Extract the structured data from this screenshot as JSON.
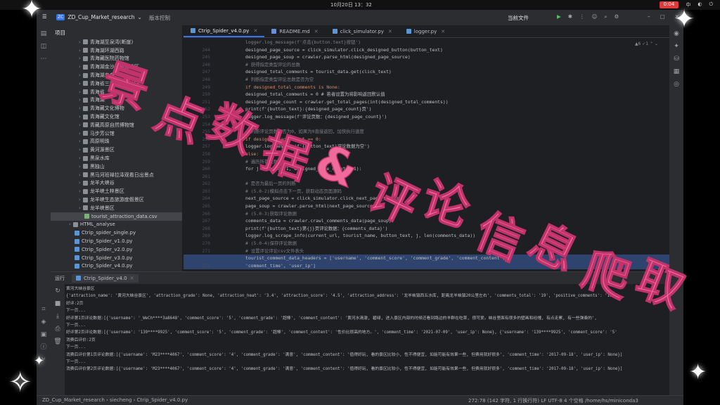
{
  "os": {
    "clock": "10月20日 13：32",
    "rec": "0:04",
    "indicators": [
      "中",
      "◐",
      "⏻"
    ]
  },
  "ide": {
    "project_badge": "ZC",
    "project_name": "ZD_Cup_Market_research",
    "version_control": "版本控制",
    "run_config": "当前文件",
    "project_panel_title": "项目"
  },
  "tree": [
    {
      "label": "青海湖至泉湾(断崖)",
      "indent": 40,
      "type": "folder"
    },
    {
      "label": "青海湖环湖西路",
      "indent": 40,
      "type": "folder"
    },
    {
      "label": "青海藏医院药物馆",
      "indent": 40,
      "type": "folder"
    },
    {
      "label": "青海湖金沙湾旅游景区",
      "indent": 40,
      "type": "folder"
    },
    {
      "label": "青海湖鸟岛",
      "indent": 40,
      "type": "folder"
    },
    {
      "label": "青海省三江源国家公园",
      "indent": 40,
      "type": "folder"
    },
    {
      "label": "青海省",
      "indent": 40,
      "type": "folder"
    },
    {
      "label": "青海湖",
      "indent": 40,
      "type": "folder"
    },
    {
      "label": "青海藏文化博物",
      "indent": 40,
      "type": "folder"
    },
    {
      "label": "青海藏文化馆",
      "indent": 40,
      "type": "folder"
    },
    {
      "label": "青藏高原自然博物馆",
      "indent": 40,
      "type": "folder"
    },
    {
      "label": "马步芳公馆",
      "indent": 40,
      "type": "folder"
    },
    {
      "label": "高原明珠",
      "indent": 40,
      "type": "folder"
    },
    {
      "label": "黄河源景区",
      "indent": 40,
      "type": "folder"
    },
    {
      "label": "黑泉水库",
      "indent": 40,
      "type": "folder"
    },
    {
      "label": "黑独山",
      "indent": 40,
      "type": "folder"
    },
    {
      "label": "黑马河班禅拉泽观看日出景点",
      "indent": 40,
      "type": "folder"
    },
    {
      "label": "龙羊大峡谷",
      "indent": 40,
      "type": "folder"
    },
    {
      "label": "龙羊峡土林景区",
      "indent": 40,
      "type": "folder"
    },
    {
      "label": "龙羊峡生态旅游度假景区",
      "indent": 40,
      "type": "folder"
    },
    {
      "label": "龙羊峡景区",
      "indent": 40,
      "type": "folder"
    },
    {
      "label": "tourist_attraction_data.csv",
      "indent": 40,
      "type": "csv",
      "selected": true
    },
    {
      "label": "HTML_analyse",
      "indent": 26,
      "type": "folder"
    },
    {
      "label": "Ctrip_spider_single.py",
      "indent": 26,
      "type": "file"
    },
    {
      "label": "Ctrip_Spider_v1.0.py",
      "indent": 26,
      "type": "file"
    },
    {
      "label": "Ctrip_Spider_v2.0.py",
      "indent": 26,
      "type": "file"
    },
    {
      "label": "Ctrip_Spider_v3.0.py",
      "indent": 26,
      "type": "file"
    },
    {
      "label": "Ctrip_Spider_v4.0.py",
      "indent": 26,
      "type": "file"
    }
  ],
  "tabs": [
    {
      "label": "Ctrip_Spider_v4.0.py",
      "active": true
    },
    {
      "label": "README.md",
      "active": false
    },
    {
      "label": "click_simulator.py",
      "active": false
    },
    {
      "label": "logger.py",
      "active": false
    }
  ],
  "inspection": "▲6 ✓1 ⌃ ⌄",
  "code_lines": [
    {
      "n": "",
      "text": "logger.log_message(f'点击{button.text}按钮')",
      "cls": "cm"
    },
    {
      "n": "244",
      "text": "designed_page_source = click_simulator.click_designed_button(button_text)",
      "cls": ""
    },
    {
      "n": "245",
      "text": "designed_page_soup = crawler.parse_html(designed_page_source)",
      "cls": ""
    },
    {
      "n": "246",
      "text": "# 获得指定类型评论的总数",
      "cls": "cm"
    },
    {
      "n": "247",
      "text": "designed_total_comments = tourist_data.get(click_text)",
      "cls": ""
    },
    {
      "n": "248",
      "text": "# 判断指定类型评论总数是否为空",
      "cls": "cm"
    },
    {
      "n": "249",
      "text": "if designed_total_comments is None:",
      "cls": "kw"
    },
    {
      "n": "250",
      "text": "    designed_total_comments = 0  # 若者设置为将影响返回默认值",
      "cls": ""
    },
    {
      "n": "251",
      "text": "designed_page_count = crawler.get_total_pages(int(designed_total_comments))",
      "cls": ""
    },
    {
      "n": "252",
      "text": "print(f'{button_text}:{designed_page_count}页')",
      "cls": ""
    },
    {
      "n": "253",
      "text": "logger.log_message(f'评论页数：{designed_page_count}')",
      "cls": ""
    },
    {
      "n": "254",
      "text": "",
      "cls": ""
    },
    {
      "n": "255",
      "text": "# 判断评论页数是否为0，如果为0直接返回，加快执行速度",
      "cls": "cm"
    },
    {
      "n": "256",
      "text": "if designed_page_count == 0:",
      "cls": "kw"
    },
    {
      "n": "257",
      "text": "    logger.log_message(f'{button_text}评论数据为空')",
      "cls": ""
    },
    {
      "n": "258",
      "text": "else:",
      "cls": "kw"
    },
    {
      "n": "259",
      "text": "    # 遍历所有页数",
      "cls": "cm"
    },
    {
      "n": "260",
      "text": "    for j in range(1, designed_page_count + 1):",
      "cls": ""
    },
    {
      "n": "261",
      "text": "",
      "cls": ""
    },
    {
      "n": "262",
      "text": "        # 是否为最后一页的判断",
      "cls": "cm"
    },
    {
      "n": "263",
      "text": "        # (5.0-2)模拟点击下一页，获取动态页面源码",
      "cls": "cm"
    },
    {
      "n": "264",
      "text": "        next_page_source = click_simulator.click_next_page_button()",
      "cls": ""
    },
    {
      "n": "265",
      "text": "        page_soup = crawler.parse_html(next_page_source)",
      "cls": ""
    },
    {
      "n": "266",
      "text": "        # (5.0-3)获取评论数据",
      "cls": "cm"
    },
    {
      "n": "267",
      "text": "        comments_data = crawler.crawl_comments_data(page_soup)",
      "cls": ""
    },
    {
      "n": "268",
      "text": "        print(f'{button_text}第{j}页评论数据：{comments_data}')",
      "cls": ""
    },
    {
      "n": "269",
      "text": "        logger.log_scrape_info(current_url, tourist_name, button_text, j, len(comments_data))",
      "cls": ""
    },
    {
      "n": "270",
      "text": "        # (5.0-4)保存评论数据",
      "cls": "cm"
    },
    {
      "n": "271",
      "text": "        # 设置评论评论csv文件表头",
      "cls": "cm"
    },
    {
      "n": "",
      "text": "        tourist_comment_data_headers = ['username', 'comment_score', 'comment_grade', 'comment_content',",
      "cls": "",
      "hl": true
    },
    {
      "n": "272",
      "text": "                                        'comment_time', 'user_ip']",
      "cls": "",
      "hl": true
    }
  ],
  "run": {
    "panel_title": "运行",
    "tab": "Ctrip_Spider_v4.0"
  },
  "console_lines": [
    "黄河大峡谷景区",
    "{'attraction_name': '黄河大峡谷景区', 'attraction_grade': None, 'attraction_heat': '3.4', 'attraction_score': '4.5', 'attraction_address': '龙羊峡镇西五水库, 距离龙羊峡镇20公里左右', 'comments_total': '19', 'positive_comments': '10'",
    "好评:2页",
    "下一页...",
    "好评第1页评论数据:[{'username': '_WeCh****3a8648', 'comment_score': '5', 'comment_grade': '超棒', 'comment_content': '黄河水清澈, 碧绿, 进入景区内部的时候还看到路边的羊群在吃草, 很可爱。峡谷里面有很多的壁画和经幢, 有点走累, 有一些弹奏的',",
    "下一页...",
    "好评第2页评论数据:[{'username': '139****9925', 'comment_score': '5', 'comment_grade': '超棒', 'comment_content': '性价比很高的地方。', 'comment_time': '2021-07-09', 'user_ip': None}, {'username': '139****9925', 'comment_score': '5'",
    "消费后评价:2页",
    "下一页...",
    "消费后评价第1页评论数据:[{'username': 'M23****4067', 'comment_score': '4', 'comment_grade': '满意', 'comment_content': '值得好玩, 看的景区比较小, 性不得便宜, 如能可能有效果一些, 但费用就好很多', 'comment_time': '2017-09-18', 'user_ip': None}]",
    "下一页...",
    "消费后评价第2页评论数据:[{'username': 'M23****4067', 'comment_score': '4', 'comment_grade': '满意', 'comment_content': '值得好玩, 看的景区比较小, 性不得便宜, 如能可能有效果一些, 但费用就好很多', 'comment_time': '2017-09-18', 'user_ip': None}]"
  ],
  "status": {
    "breadcrumb": "ZD_Cup_Market_research  ›  siecheng  ›  Ctrip_Spider_v4.0.py",
    "position": "272:78 (142 字符, 1 行换行符)   LF   UTF-8   4 个空格   /home/hs/miniconda3"
  },
  "overlay_text": "景点数据&评论信息爬取",
  "colors": {
    "overlay_pink": "#f06a9a",
    "accent": "#3574f0"
  }
}
